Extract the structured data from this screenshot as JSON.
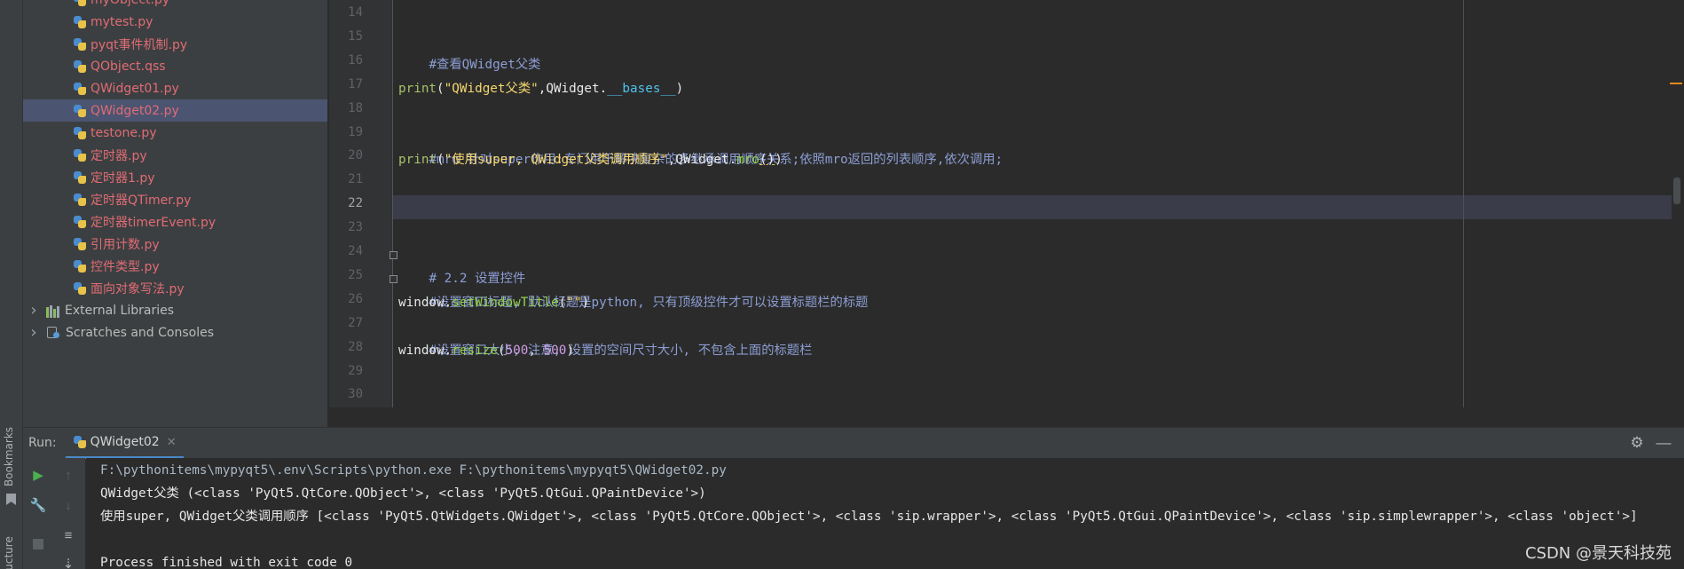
{
  "left_strip": {
    "bookmarks_label": "Bookmarks",
    "structure_label": "Structure"
  },
  "project_tree": {
    "files": [
      {
        "name": "myObject.py",
        "selected": false
      },
      {
        "name": "mytest.py",
        "selected": false
      },
      {
        "name": "pyqt事件机制.py",
        "selected": false
      },
      {
        "name": "QObject.qss",
        "selected": false
      },
      {
        "name": "QWidget01.py",
        "selected": false
      },
      {
        "name": "QWidget02.py",
        "selected": true
      },
      {
        "name": "testone.py",
        "selected": false
      },
      {
        "name": "定时器.py",
        "selected": false
      },
      {
        "name": "定时器1.py",
        "selected": false
      },
      {
        "name": "定时器QTimer.py",
        "selected": false
      },
      {
        "name": "定时器timerEvent.py",
        "selected": false
      },
      {
        "name": "引用计数.py",
        "selected": false
      },
      {
        "name": "控件类型.py",
        "selected": false
      },
      {
        "name": "面向对象写法.py",
        "selected": false
      }
    ],
    "external_libraries": "External Libraries",
    "scratches": "Scratches and Consoles"
  },
  "editor": {
    "current_line": 22,
    "line_numbers": [
      "14",
      "15",
      "16",
      "17",
      "18",
      "19",
      "20",
      "21",
      "22",
      "23",
      "24",
      "25",
      "26",
      "27",
      "28",
      "29",
      "30"
    ],
    "lines": {
      "l15_comment": "#查看QWidget父类",
      "l17_print": "print",
      "l17_str": "\"QWidget父类\"",
      "l17_obj": ",QWidget.",
      "l17_attr": "__bases__",
      "l19_comment": "#mro 针对super作用:专门用于解决复杂的多继承调用顺序关系;依照mro返回的列表顺序,依次调用;",
      "l20_print": "print",
      "l20_str": "\"使用super, QWidget父类调用顺序\"",
      "l20_obj": ",QWidget.",
      "l20_method": "mro",
      "l24_comment": "# 2.2 设置控件",
      "l25_comment": "#设置窗口标题, 默认标题是python, 只有顶级控件才可以设置标题栏的标题",
      "l26_obj": "window.",
      "l26_method": "setWindowTitle",
      "l26_str": "\"\"",
      "l27_comment": "#设置窗口大小, 注意, 设置的空间尺寸大小, 不包含上面的标题栏",
      "l28_obj": "window.",
      "l28_method": "resize",
      "l28_num1": "500",
      "l28_num2": "500"
    }
  },
  "run_panel": {
    "label": "Run:",
    "tab_name": "QWidget02",
    "console": [
      "F:\\pythonitems\\mypyqt5\\.env\\Scripts\\python.exe F:\\pythonitems\\mypyqt5\\QWidget02.py",
      "QWidget父类 (<class 'PyQt5.QtCore.QObject'>, <class 'PyQt5.QtGui.QPaintDevice'>)",
      "使用super, QWidget父类调用顺序 [<class 'PyQt5.QtWidgets.QWidget'>, <class 'PyQt5.QtCore.QObject'>, <class 'sip.wrapper'>, <class 'PyQt5.QtGui.QPaintDevice'>, <class 'sip.simplewrapper'>, <class 'object'>]",
      "",
      "Process finished with exit code 0"
    ]
  },
  "watermark": "CSDN @景天科技苑",
  "colors": {
    "file_red": "#e06c75",
    "selection": "#4b5470",
    "comment": "#8c9ed4",
    "string": "#f5d76e",
    "run_green": "#4caf50"
  }
}
